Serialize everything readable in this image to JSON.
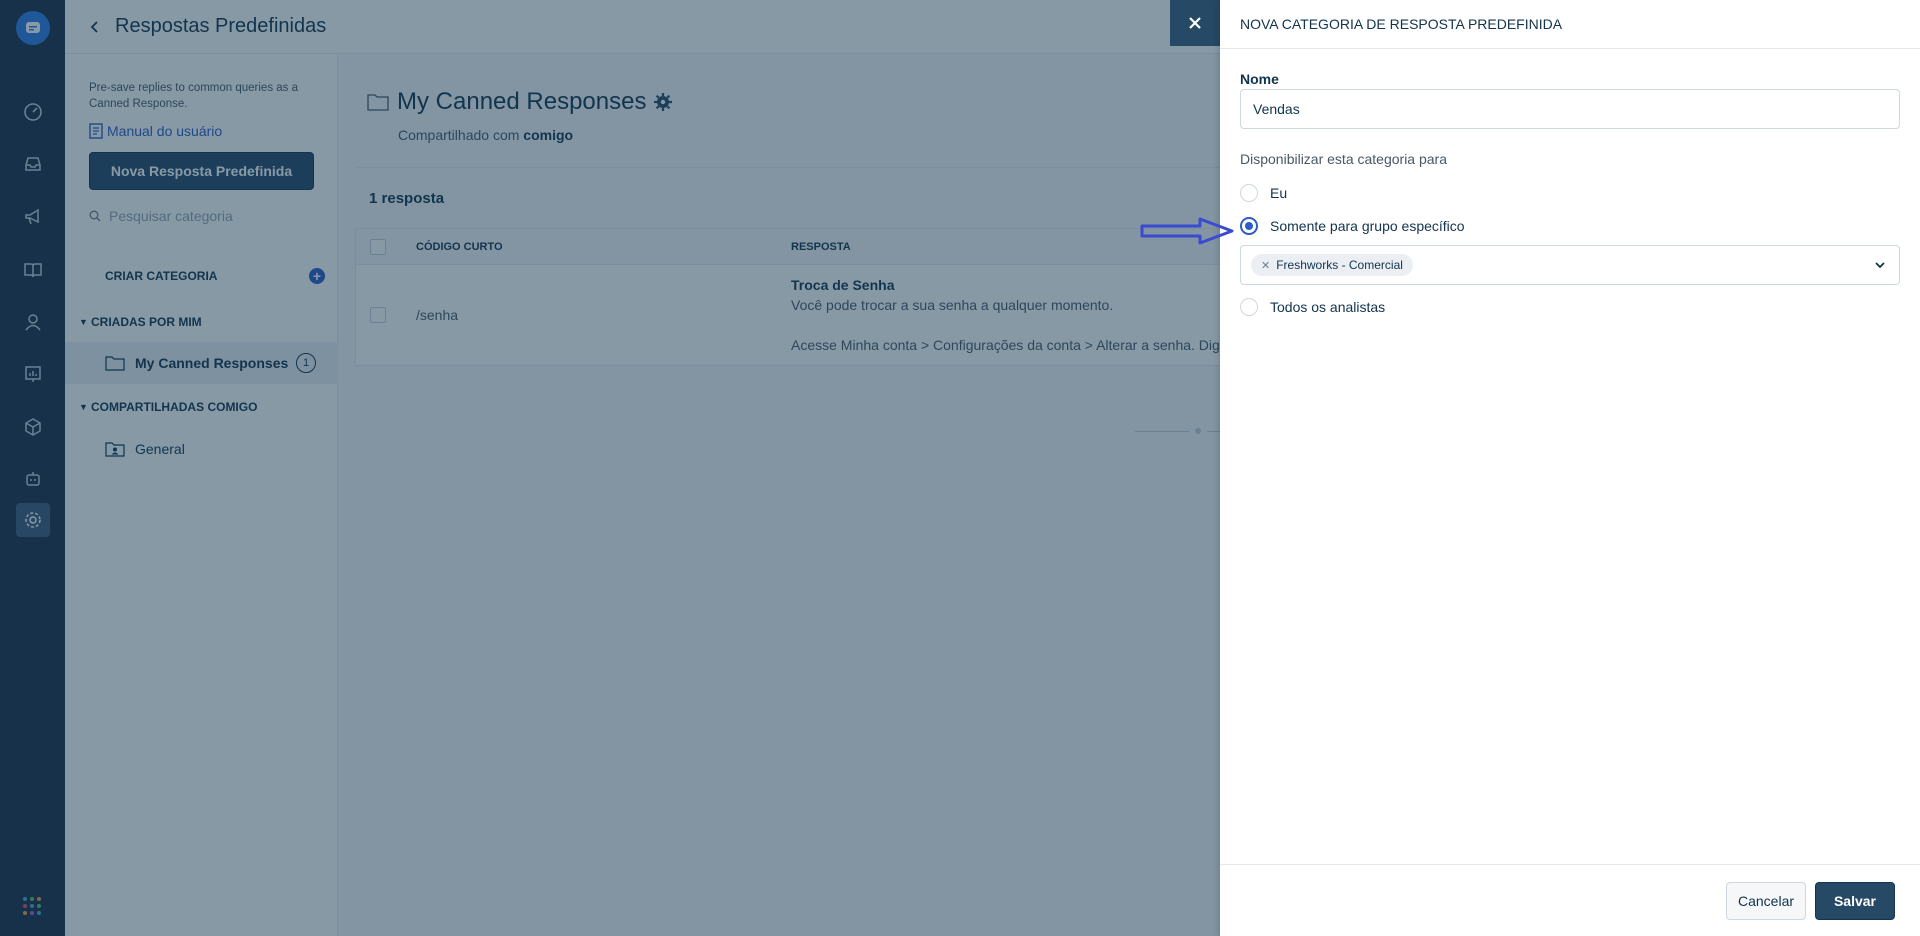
{
  "page": {
    "title": "Respostas Predefinidas",
    "description": "Pre-save replies to common queries as a Canned Response.",
    "manual_link": "Manual do usuário",
    "new_button": "Nova Resposta Predefinida",
    "search_placeholder": "Pesquisar categoria"
  },
  "sidebar": {
    "create_label": "CRIAR CATEGORIA",
    "sections": [
      {
        "label": "CRIADAS POR MIM",
        "items": [
          {
            "label": "My Canned Responses",
            "count": "1"
          }
        ]
      },
      {
        "label": "COMPARTILHADAS COMIGO",
        "items": [
          {
            "label": "General"
          }
        ]
      }
    ]
  },
  "main": {
    "folder_title": "My Canned Responses",
    "shared_prefix": "Compartilhado com",
    "shared_with": "comigo",
    "count_label": "1 resposta",
    "table": {
      "headers": [
        "CÓDIGO CURTO",
        "RESPOSTA"
      ],
      "rows": [
        {
          "code": "/senha",
          "title": "Troca de Senha",
          "line1": "Você pode trocar a sua senha a qualquer momento.",
          "line2": "Acesse Minha conta > Configurações da conta > Alterar a senha. Dig"
        }
      ]
    }
  },
  "drawer": {
    "title": "NOVA CATEGORIA DE RESPOSTA PREDEFINIDA",
    "name_label": "Nome",
    "name_value": "Vendas",
    "avail_label": "Disponibilizar esta categoria para",
    "options": [
      {
        "label": "Eu",
        "selected": false
      },
      {
        "label": "Somente para grupo específico",
        "selected": true
      },
      {
        "label": "Todos os analistas",
        "selected": false
      }
    ],
    "group_tag": "Freshworks - Comercial",
    "cancel": "Cancelar",
    "save": "Salvar"
  },
  "colors": {
    "rail": "#1a2e44",
    "accent": "#2c5cc5",
    "primary_button": "#264966",
    "annotation_arrow": "#3b4bd1"
  }
}
